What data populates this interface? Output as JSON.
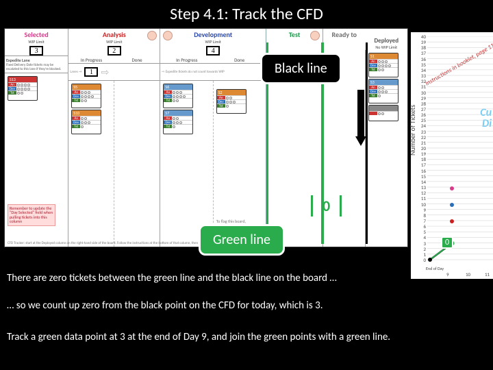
{
  "title": "Step 4.1: Track the CFD",
  "board": {
    "columns": {
      "selected": {
        "name": "Selected",
        "sub": "WIP Limit",
        "wip": "3"
      },
      "analysis": {
        "name": "Analysis",
        "sub": "WIP Limit",
        "wip": "2",
        "in_progress": "In Progress",
        "done": "Done"
      },
      "development": {
        "name": "Development",
        "sub": "WIP Limit",
        "wip": "4",
        "in_progress": "In Progress",
        "done": "Done"
      },
      "test": {
        "name": "Test"
      },
      "ready": {
        "name": "Ready to"
      },
      "deployed": {
        "name": "Deployed",
        "sub": "No WIP Limit"
      }
    },
    "expedite": {
      "label": "Expedite Lane",
      "wip": "1",
      "note": "Fixed Delivery Date tickets may be escalated to this lane if they're blocked."
    },
    "cards": {
      "s13": "S13",
      "s5": "S5",
      "s10": "S10",
      "s6": "S6",
      "s7": "S7",
      "s2": "S2",
      "s1": "S1",
      "s3": "S3"
    },
    "card_rows": {
      "a": "An",
      "b": "Dev",
      "c": "Tst",
      "d": "Qty"
    },
    "note_remember": "Remember to update the \"Day Selected\" field when pulling tickets into this column",
    "note_flag": "To flag this board, lift the middle then lift the sides",
    "tracker_note": "CFD Tracker: start at the Deployed column on the right-hand side of the board. Follow the instructions at the bottom of that column, then work your way left across the board."
  },
  "callouts": {
    "black": "Black line",
    "green": "Green line",
    "zero": "0"
  },
  "captions": {
    "line1": "There are zero tickets between the green line and the black line on the board …",
    "line2": "… so we count up zero from the black point on the CFD for today, which is 3.",
    "line3": "Track a green data point at 3 at the end of Day 9, and join the green points with a green line."
  },
  "chart_data": {
    "type": "line",
    "title_watermark_1": "Cu",
    "title_watermark_2": "Di",
    "instructions": "Instructions in booklet, page 11",
    "ylabel": "Number of Tickets",
    "xlabel": "End of Day",
    "ylim": [
      0,
      40
    ],
    "yticks": [
      0,
      1,
      2,
      3,
      4,
      5,
      6,
      7,
      8,
      9,
      10,
      11,
      12,
      13,
      14,
      15,
      16,
      17,
      18,
      19,
      20,
      21,
      22,
      23,
      24,
      25,
      26,
      27,
      28,
      29,
      30,
      31,
      32,
      33,
      34,
      35,
      36,
      37,
      38,
      39,
      40
    ],
    "xticks_visible": [
      9,
      10,
      11
    ],
    "series": [
      {
        "name": "black",
        "color": "#000000",
        "points": [
          {
            "x": 8,
            "y": 0
          },
          {
            "x": 9,
            "y": 3
          }
        ]
      },
      {
        "name": "green",
        "color": "#2aac4d",
        "points": [
          {
            "x": 8,
            "y": 0
          },
          {
            "x": 9,
            "y": 3
          }
        ]
      },
      {
        "name": "red_marker",
        "color": "#cc2020",
        "points": [
          {
            "x": 9,
            "y": 7
          }
        ]
      },
      {
        "name": "blue_marker",
        "color": "#2a6db8",
        "points": [
          {
            "x": 9,
            "y": 10
          }
        ]
      },
      {
        "name": "pink_marker",
        "color": "#d83b8a",
        "points": [
          {
            "x": 9,
            "y": 13
          }
        ]
      }
    ],
    "zero_badge": "0"
  }
}
